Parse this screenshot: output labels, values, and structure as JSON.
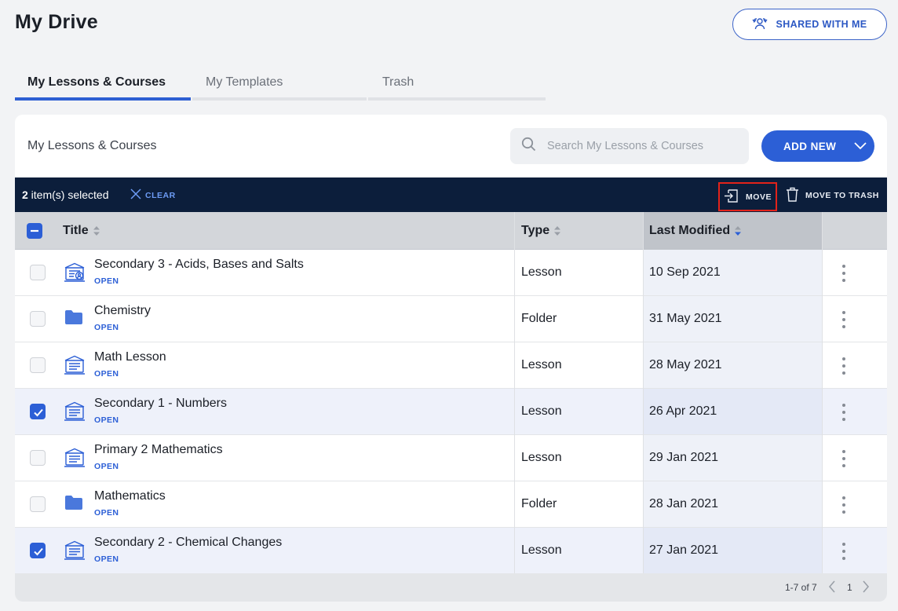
{
  "page_title": "My Drive",
  "shared_button": "SHARED WITH ME",
  "tabs": [
    {
      "label": "My Lessons & Courses",
      "active": true
    },
    {
      "label": "My Templates",
      "active": false
    },
    {
      "label": "Trash",
      "active": false
    }
  ],
  "panel": {
    "title": "My Lessons & Courses",
    "search_placeholder": "Search My Lessons & Courses",
    "add_new": "ADD NEW"
  },
  "selection": {
    "count": "2",
    "suffix": " item(s) selected",
    "clear": "CLEAR",
    "move": "MOVE",
    "move_to_trash": "MOVE TO TRASH"
  },
  "columns": {
    "title": "Title",
    "type": "Type",
    "last_modified": "Last Modified"
  },
  "rows": [
    {
      "name": "Secondary 3 - Acids, Bases and Salts",
      "open": "OPEN",
      "type": "Lesson",
      "date": "10 Sep 2021",
      "icon": "shared-lesson-icon",
      "selected": false
    },
    {
      "name": "Chemistry",
      "open": "OPEN",
      "type": "Folder",
      "date": "31 May 2021",
      "icon": "folder-icon",
      "selected": false
    },
    {
      "name": "Math Lesson",
      "open": "OPEN",
      "type": "Lesson",
      "date": "28 May 2021",
      "icon": "lesson-icon",
      "selected": false
    },
    {
      "name": "Secondary 1 - Numbers",
      "open": "OPEN",
      "type": "Lesson",
      "date": "26 Apr 2021",
      "icon": "lesson-icon",
      "selected": true
    },
    {
      "name": "Primary 2 Mathematics",
      "open": "OPEN",
      "type": "Lesson",
      "date": "29 Jan 2021",
      "icon": "lesson-icon",
      "selected": false
    },
    {
      "name": "Mathematics",
      "open": "OPEN",
      "type": "Folder",
      "date": "28 Jan 2021",
      "icon": "folder-icon",
      "selected": false
    },
    {
      "name": "Secondary 2 - Chemical Changes",
      "open": "OPEN",
      "type": "Lesson",
      "date": "27 Jan 2021",
      "icon": "lesson-icon",
      "selected": true
    }
  ],
  "pagination": {
    "range": "1-7 of 7",
    "page": "1"
  },
  "colors": {
    "accent": "#2c5fd6",
    "selection_bar": "#0c1e3b",
    "highlight": "#e2231a"
  }
}
